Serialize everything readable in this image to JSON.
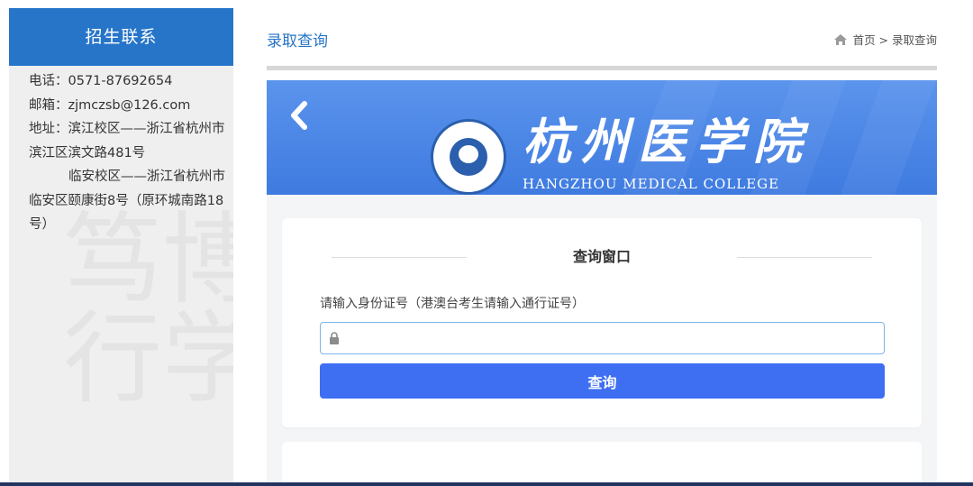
{
  "sidebar": {
    "title": "招生联系",
    "phone": "电话：0571-87692654",
    "email": "邮箱：zjmczsb@126.com",
    "address_line1": "地址：滨江校区——浙江省杭州市",
    "address_line2": "滨江区滨文路481号",
    "address_line3": "临安校区——浙江省杭州市",
    "address_line4": "临安区颐康街8号（原环城南路18",
    "address_line5": "号）",
    "watermark": "博学笃行"
  },
  "header": {
    "page_title": "录取查询",
    "breadcrumb": "首页 > 录取查询"
  },
  "banner": {
    "logo_cn": "杭州医学院",
    "logo_en": "HANGZHOU MEDICAL COLLEGE",
    "color": "#4b86e6"
  },
  "query": {
    "card_title": "查询窗口",
    "input_label": "请输入身份证号（港澳台考生请输入通行证号）",
    "input_value": "",
    "input_placeholder": "",
    "button_label": "查询",
    "button_color": "#3e6ff2"
  },
  "colors": {
    "accent": "#2775c9",
    "sidebar_bg": "#efefef",
    "bottom_bar": "#21355e"
  },
  "icons": {
    "home": "home-icon",
    "back": "chevron-left-icon",
    "lock": "lock-icon"
  }
}
